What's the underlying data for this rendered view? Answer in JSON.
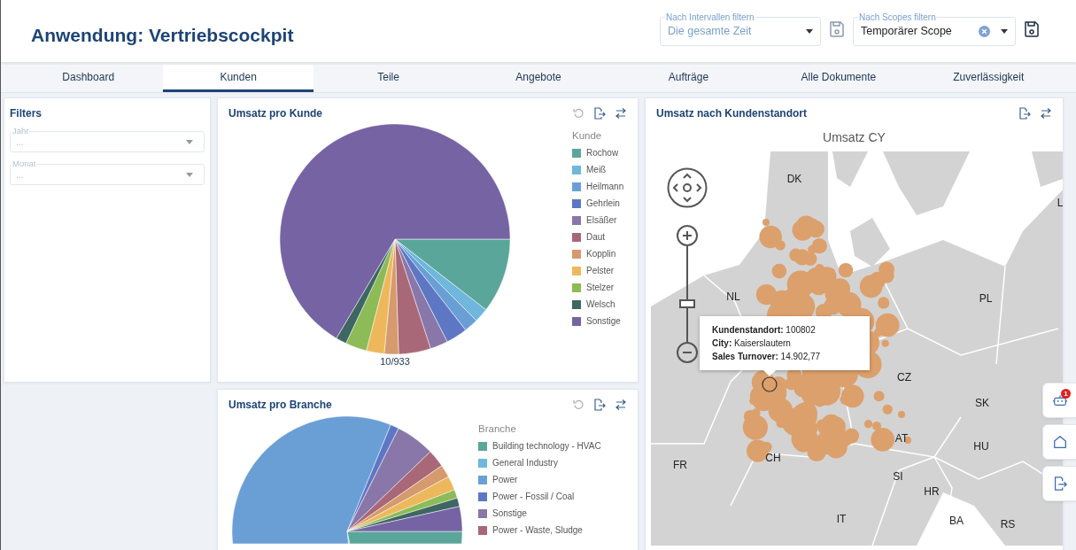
{
  "app_title": "Anwendung: Vertriebscockpit",
  "header_filters": [
    {
      "label": "Nach Intervallen filtern",
      "placeholder": "Die gesamte Zeit",
      "clearable": false,
      "save_disabled": true
    },
    {
      "label": "Nach Scopes filtern",
      "value": "Temporärer Scope",
      "clearable": true,
      "save_disabled": false
    }
  ],
  "tabs": [
    {
      "label": "Dashboard",
      "selected": false
    },
    {
      "label": "Kunden",
      "selected": true
    },
    {
      "label": "Teile",
      "selected": false
    },
    {
      "label": "Angebote",
      "selected": false
    },
    {
      "label": "Aufträge",
      "selected": false
    },
    {
      "label": "Alle Dokumente",
      "selected": false
    },
    {
      "label": "Zuverlässigkeit",
      "selected": false
    }
  ],
  "filters": {
    "title": "Filters",
    "fields": [
      {
        "label": "Jahr",
        "placeholder": "..."
      },
      {
        "label": "Monat",
        "placeholder": "..."
      }
    ]
  },
  "pie_cards": [
    {
      "title": "Umsatz pro Kunde",
      "legend_title": "Kunde",
      "footer": "10/933",
      "legend": [
        {
          "label": "Rochow",
          "color": "#5ba69a"
        },
        {
          "label": "Meiß",
          "color": "#6fb7dc"
        },
        {
          "label": "Heilmann",
          "color": "#6a9fd6"
        },
        {
          "label": "Gehrlein",
          "color": "#5d77c4"
        },
        {
          "label": "Elsäßer",
          "color": "#8877a8"
        },
        {
          "label": "Daut",
          "color": "#a86878"
        },
        {
          "label": "Kopplin",
          "color": "#d59a6d"
        },
        {
          "label": "Pelster",
          "color": "#edb85c"
        },
        {
          "label": "Stelzer",
          "color": "#8cbb57"
        },
        {
          "label": "Welsch",
          "color": "#3e6662"
        },
        {
          "label": "Sonstige",
          "color": "#7563a4"
        }
      ]
    },
    {
      "title": "Umsatz pro Branche",
      "legend_title": "Branche",
      "legend": [
        {
          "label": "Building technology - HVAC",
          "color": "#5ba69a"
        },
        {
          "label": "General Industry",
          "color": "#6fb7dc"
        },
        {
          "label": "Power",
          "color": "#6a9fd6"
        },
        {
          "label": "Power - Fossil / Coal",
          "color": "#5d77c4"
        },
        {
          "label": "Sonstige",
          "color": "#8877a8"
        },
        {
          "label": "Power - Waste, Sludge",
          "color": "#a86878"
        }
      ]
    }
  ],
  "map_card": {
    "title": "Umsatz nach Kundenstandort",
    "subtitle": "Umsatz CY",
    "countries": [
      "DK",
      "NL",
      "PL",
      "CZ",
      "SK",
      "AT",
      "HU",
      "CH",
      "FR",
      "SI",
      "HR",
      "IT",
      "BA",
      "RS",
      "L"
    ],
    "zoom_slider": {
      "level": 0.4
    },
    "tooltip": [
      "**Kundenstandort:** 100802",
      "**City:** Kaiserslautern",
      "**Sales Turnover:** 14.902,77"
    ]
  },
  "side_buttons": [
    {
      "kind": "robot",
      "badge": "1"
    },
    {
      "kind": "home"
    },
    {
      "kind": "export"
    }
  ]
}
